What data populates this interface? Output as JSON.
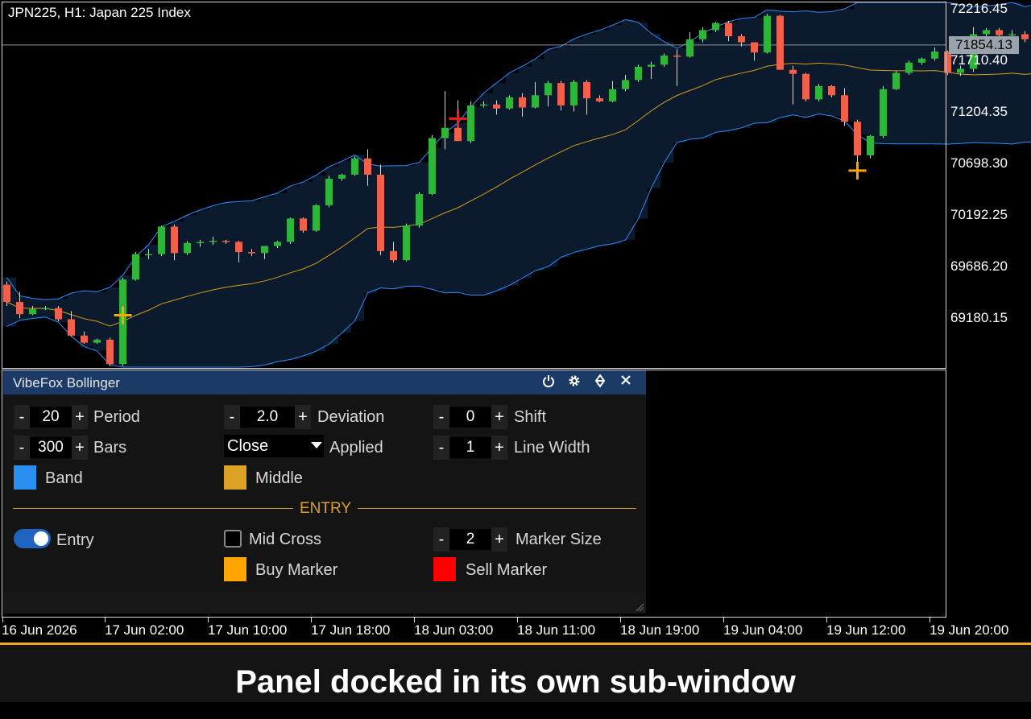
{
  "chart": {
    "symbol_label": "JPN225, H1:  Japan 225 Index",
    "price_labels": [
      "72216.45",
      "71710.40",
      "71204.35",
      "70698.30",
      "70192.25",
      "69686.20",
      "69180.15"
    ],
    "current_price": "71854.13",
    "time_labels": [
      "16 Jun 2026",
      "17 Jun 02:00",
      "17 Jun 10:00",
      "17 Jun 18:00",
      "18 Jun 03:00",
      "18 Jun 11:00",
      "18 Jun 19:00",
      "19 Jun 04:00",
      "19 Jun 12:00",
      "19 Jun 20:00"
    ],
    "colors": {
      "bull": "#2fb63a",
      "bear": "#f0614c",
      "band": "#2f8cff",
      "middle": "#d4a017",
      "band_fill": "#0b1a2c",
      "buy_marker": "#ffa500",
      "sell_marker": "#ff1a1a"
    }
  },
  "chart_data": {
    "type": "candlestick",
    "candles": [
      {
        "o": 69500,
        "h": 69530,
        "l": 69290,
        "c": 69330
      },
      {
        "o": 69330,
        "h": 69430,
        "l": 69170,
        "c": 69210
      },
      {
        "o": 69210,
        "h": 69290,
        "l": 69200,
        "c": 69260
      },
      {
        "o": 69260,
        "h": 69290,
        "l": 69250,
        "c": 69270
      },
      {
        "o": 69270,
        "h": 69290,
        "l": 69140,
        "c": 69160
      },
      {
        "o": 69160,
        "h": 69240,
        "l": 68990,
        "c": 69000
      },
      {
        "o": 69000,
        "h": 69040,
        "l": 68920,
        "c": 68930
      },
      {
        "o": 68930,
        "h": 68970,
        "l": 68920,
        "c": 68960
      },
      {
        "o": 68960,
        "h": 68980,
        "l": 68700,
        "c": 68720
      },
      {
        "o": 68720,
        "h": 69570,
        "l": 68700,
        "c": 69550
      },
      {
        "o": 69550,
        "h": 69820,
        "l": 69540,
        "c": 69800
      },
      {
        "o": 69800,
        "h": 69850,
        "l": 69750,
        "c": 69800
      },
      {
        "o": 69800,
        "h": 70080,
        "l": 69780,
        "c": 70070
      },
      {
        "o": 70070,
        "h": 70090,
        "l": 69740,
        "c": 69810
      },
      {
        "o": 69810,
        "h": 69930,
        "l": 69790,
        "c": 69910
      },
      {
        "o": 69910,
        "h": 69940,
        "l": 69870,
        "c": 69920
      },
      {
        "o": 69920,
        "h": 69970,
        "l": 69890,
        "c": 69930
      },
      {
        "o": 69930,
        "h": 69940,
        "l": 69900,
        "c": 69920
      },
      {
        "o": 69920,
        "h": 69930,
        "l": 69720,
        "c": 69820
      },
      {
        "o": 69820,
        "h": 69850,
        "l": 69780,
        "c": 69810
      },
      {
        "o": 69810,
        "h": 69880,
        "l": 69750,
        "c": 69880
      },
      {
        "o": 69880,
        "h": 69930,
        "l": 69860,
        "c": 69920
      },
      {
        "o": 69920,
        "h": 70160,
        "l": 69900,
        "c": 70150
      },
      {
        "o": 70150,
        "h": 70160,
        "l": 70010,
        "c": 70030
      },
      {
        "o": 70030,
        "h": 70290,
        "l": 70020,
        "c": 70280
      },
      {
        "o": 70280,
        "h": 70570,
        "l": 70260,
        "c": 70540
      },
      {
        "o": 70540,
        "h": 70590,
        "l": 70520,
        "c": 70580
      },
      {
        "o": 70580,
        "h": 70760,
        "l": 70570,
        "c": 70740
      },
      {
        "o": 70740,
        "h": 70830,
        "l": 70470,
        "c": 70580
      },
      {
        "o": 70580,
        "h": 70680,
        "l": 69790,
        "c": 69830
      },
      {
        "o": 69830,
        "h": 69920,
        "l": 69720,
        "c": 69740
      },
      {
        "o": 69740,
        "h": 70100,
        "l": 69730,
        "c": 70080
      },
      {
        "o": 70080,
        "h": 70410,
        "l": 70060,
        "c": 70390
      },
      {
        "o": 70390,
        "h": 70970,
        "l": 70380,
        "c": 70940
      },
      {
        "o": 70940,
        "h": 71400,
        "l": 70830,
        "c": 71040
      },
      {
        "o": 71040,
        "h": 71310,
        "l": 71000,
        "c": 70910
      },
      {
        "o": 70910,
        "h": 71300,
        "l": 70890,
        "c": 71260
      },
      {
        "o": 71260,
        "h": 71300,
        "l": 71240,
        "c": 71270
      },
      {
        "o": 71270,
        "h": 71310,
        "l": 71170,
        "c": 71230
      },
      {
        "o": 71230,
        "h": 71360,
        "l": 71220,
        "c": 71340
      },
      {
        "o": 71340,
        "h": 71380,
        "l": 71150,
        "c": 71240
      },
      {
        "o": 71240,
        "h": 71490,
        "l": 71230,
        "c": 71360
      },
      {
        "o": 71360,
        "h": 71500,
        "l": 71250,
        "c": 71480
      },
      {
        "o": 71480,
        "h": 71500,
        "l": 71210,
        "c": 71260
      },
      {
        "o": 71260,
        "h": 71510,
        "l": 71200,
        "c": 71490
      },
      {
        "o": 71490,
        "h": 71510,
        "l": 71170,
        "c": 71330
      },
      {
        "o": 71330,
        "h": 71360,
        "l": 71290,
        "c": 71300
      },
      {
        "o": 71300,
        "h": 71500,
        "l": 71290,
        "c": 71420
      },
      {
        "o": 71420,
        "h": 71560,
        "l": 71400,
        "c": 71510
      },
      {
        "o": 71510,
        "h": 71660,
        "l": 71490,
        "c": 71640
      },
      {
        "o": 71640,
        "h": 71690,
        "l": 71520,
        "c": 71660
      },
      {
        "o": 71660,
        "h": 71770,
        "l": 71640,
        "c": 71750
      },
      {
        "o": 71750,
        "h": 71810,
        "l": 71450,
        "c": 71740
      },
      {
        "o": 71740,
        "h": 71980,
        "l": 71730,
        "c": 71910
      },
      {
        "o": 71910,
        "h": 72030,
        "l": 71880,
        "c": 72000
      },
      {
        "o": 72000,
        "h": 72080,
        "l": 71980,
        "c": 72070
      },
      {
        "o": 72070,
        "h": 72090,
        "l": 71890,
        "c": 71940
      },
      {
        "o": 71940,
        "h": 71960,
        "l": 71840,
        "c": 71880
      },
      {
        "o": 71880,
        "h": 71880,
        "l": 71700,
        "c": 71780
      },
      {
        "o": 71780,
        "h": 72160,
        "l": 71770,
        "c": 72140
      },
      {
        "o": 72140,
        "h": 72150,
        "l": 71610,
        "c": 71610
      },
      {
        "o": 71610,
        "h": 71650,
        "l": 71270,
        "c": 71570
      },
      {
        "o": 71570,
        "h": 71580,
        "l": 71300,
        "c": 71320
      },
      {
        "o": 71320,
        "h": 71470,
        "l": 71300,
        "c": 71450
      },
      {
        "o": 71450,
        "h": 71460,
        "l": 71340,
        "c": 71360
      },
      {
        "o": 71360,
        "h": 71430,
        "l": 71060,
        "c": 71100
      },
      {
        "o": 71100,
        "h": 71120,
        "l": 70700,
        "c": 70770
      },
      {
        "o": 70770,
        "h": 70970,
        "l": 70740,
        "c": 70960
      },
      {
        "o": 70960,
        "h": 71450,
        "l": 70940,
        "c": 71420
      },
      {
        "o": 71420,
        "h": 71600,
        "l": 71410,
        "c": 71580
      },
      {
        "o": 71580,
        "h": 71700,
        "l": 71560,
        "c": 71680
      },
      {
        "o": 71680,
        "h": 71730,
        "l": 71660,
        "c": 71720
      },
      {
        "o": 71720,
        "h": 71830,
        "l": 71700,
        "c": 71790
      },
      {
        "o": 71790,
        "h": 71800,
        "l": 71560,
        "c": 71580
      },
      {
        "o": 71580,
        "h": 71650,
        "l": 71550,
        "c": 71620
      },
      {
        "o": 71620,
        "h": 72030,
        "l": 71590,
        "c": 71960
      },
      {
        "o": 71960,
        "h": 72020,
        "l": 71900,
        "c": 72000
      },
      {
        "o": 72000,
        "h": 72020,
        "l": 71890,
        "c": 71950
      },
      {
        "o": 71950,
        "h": 72000,
        "l": 71890,
        "c": 71960
      },
      {
        "o": 71960,
        "h": 71990,
        "l": 71880,
        "c": 71910
      },
      {
        "o": 71910,
        "h": 71950,
        "l": 71850,
        "c": 71860
      }
    ],
    "buy_markers": [
      9,
      66
    ],
    "sell_markers": [
      35
    ],
    "current_price": 71854.13,
    "ylim": [
      68700,
      72260
    ]
  },
  "panel": {
    "title": "VibeFox Bollinger",
    "minus": "-",
    "plus": "+",
    "period_value": "20",
    "period_label": "Period",
    "bars_value": "300",
    "bars_label": "Bars",
    "band_label": "Band",
    "band_color": "#2b8ff0",
    "deviation_value": "2.0",
    "deviation_label": "Deviation",
    "applied_value": "Close",
    "applied_label": "Applied",
    "middle_label": "Middle",
    "middle_color": "#dba226",
    "shift_value": "0",
    "shift_label": "Shift",
    "line_width_value": "1",
    "line_width_label": "Line Width",
    "section_label": "ENTRY",
    "entry_label": "Entry",
    "mid_cross_label": "Mid Cross",
    "marker_size_value": "2",
    "marker_size_label": "Marker Size",
    "buy_marker_label": "Buy Marker",
    "buy_marker_color": "#ffa500",
    "sell_marker_label": "Sell Marker",
    "sell_marker_color": "#ff0000"
  },
  "caption": "Panel docked in its own sub-window"
}
